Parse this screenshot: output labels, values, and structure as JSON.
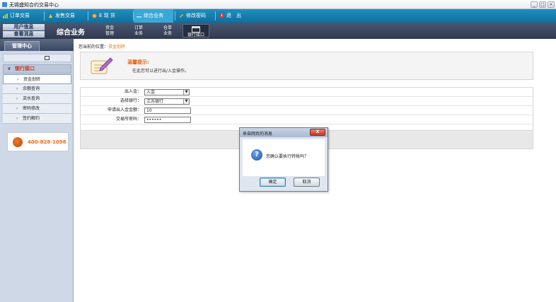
{
  "window": {
    "title": "无锡盛知合约交易中心",
    "controls": [
      "_",
      "□",
      "×"
    ]
  },
  "top_menu": {
    "items": [
      {
        "label": "订单交易",
        "icon": "chart-icon",
        "color": "#f5c242"
      },
      {
        "label": "发售交易",
        "icon": "chart-icon",
        "color": "#f5c242"
      },
      {
        "label": "E 现 货",
        "icon": "globe-icon",
        "color": "#f08c2a"
      },
      {
        "label": "综合业务",
        "icon": "card-icon",
        "color": "#7fd3f7"
      },
      {
        "label": "修改密码",
        "icon": "pencil-icon",
        "color": "#f5c242"
      },
      {
        "label": "退　出",
        "icon": "power-icon",
        "color": "#e03a3a"
      }
    ]
  },
  "sub_bar": {
    "user_links": [
      "用户信息",
      "查看消息"
    ],
    "section_title": "综合业务",
    "tabs": [
      {
        "line1": "资金",
        "line2": "管理"
      },
      {
        "line1": "订单",
        "line2": "业务"
      },
      {
        "line1": "仓单",
        "line2": "业务"
      },
      {
        "line1": "",
        "line2": "银行接口"
      }
    ]
  },
  "sidebar": {
    "tab": "管理中心",
    "group": "银行接口",
    "items": [
      "资金划转",
      "余额查询",
      "流水查询",
      "密码修改",
      "签约解约"
    ],
    "hotline": "400-828-1098"
  },
  "main": {
    "breadcrumb_prefix": "您当前的位置：",
    "breadcrumb_current": "资金划转",
    "tip_title": "温馨提示:",
    "tip_text": "在此您可以进行出/入金操作。",
    "form": {
      "direction_label": "出入金：",
      "direction_value": "入金",
      "bank_label": "选择银行：",
      "bank_value": "江苏银行",
      "amount_label": "申请出入金金额：",
      "amount_value": "10",
      "password_label": "交易所密码：",
      "password_value": "••••••"
    }
  },
  "dialog": {
    "title": "来自网页的消息",
    "close": "X",
    "message": "您确认要执行转帐吗？",
    "ok": "确定",
    "cancel": "取消"
  }
}
